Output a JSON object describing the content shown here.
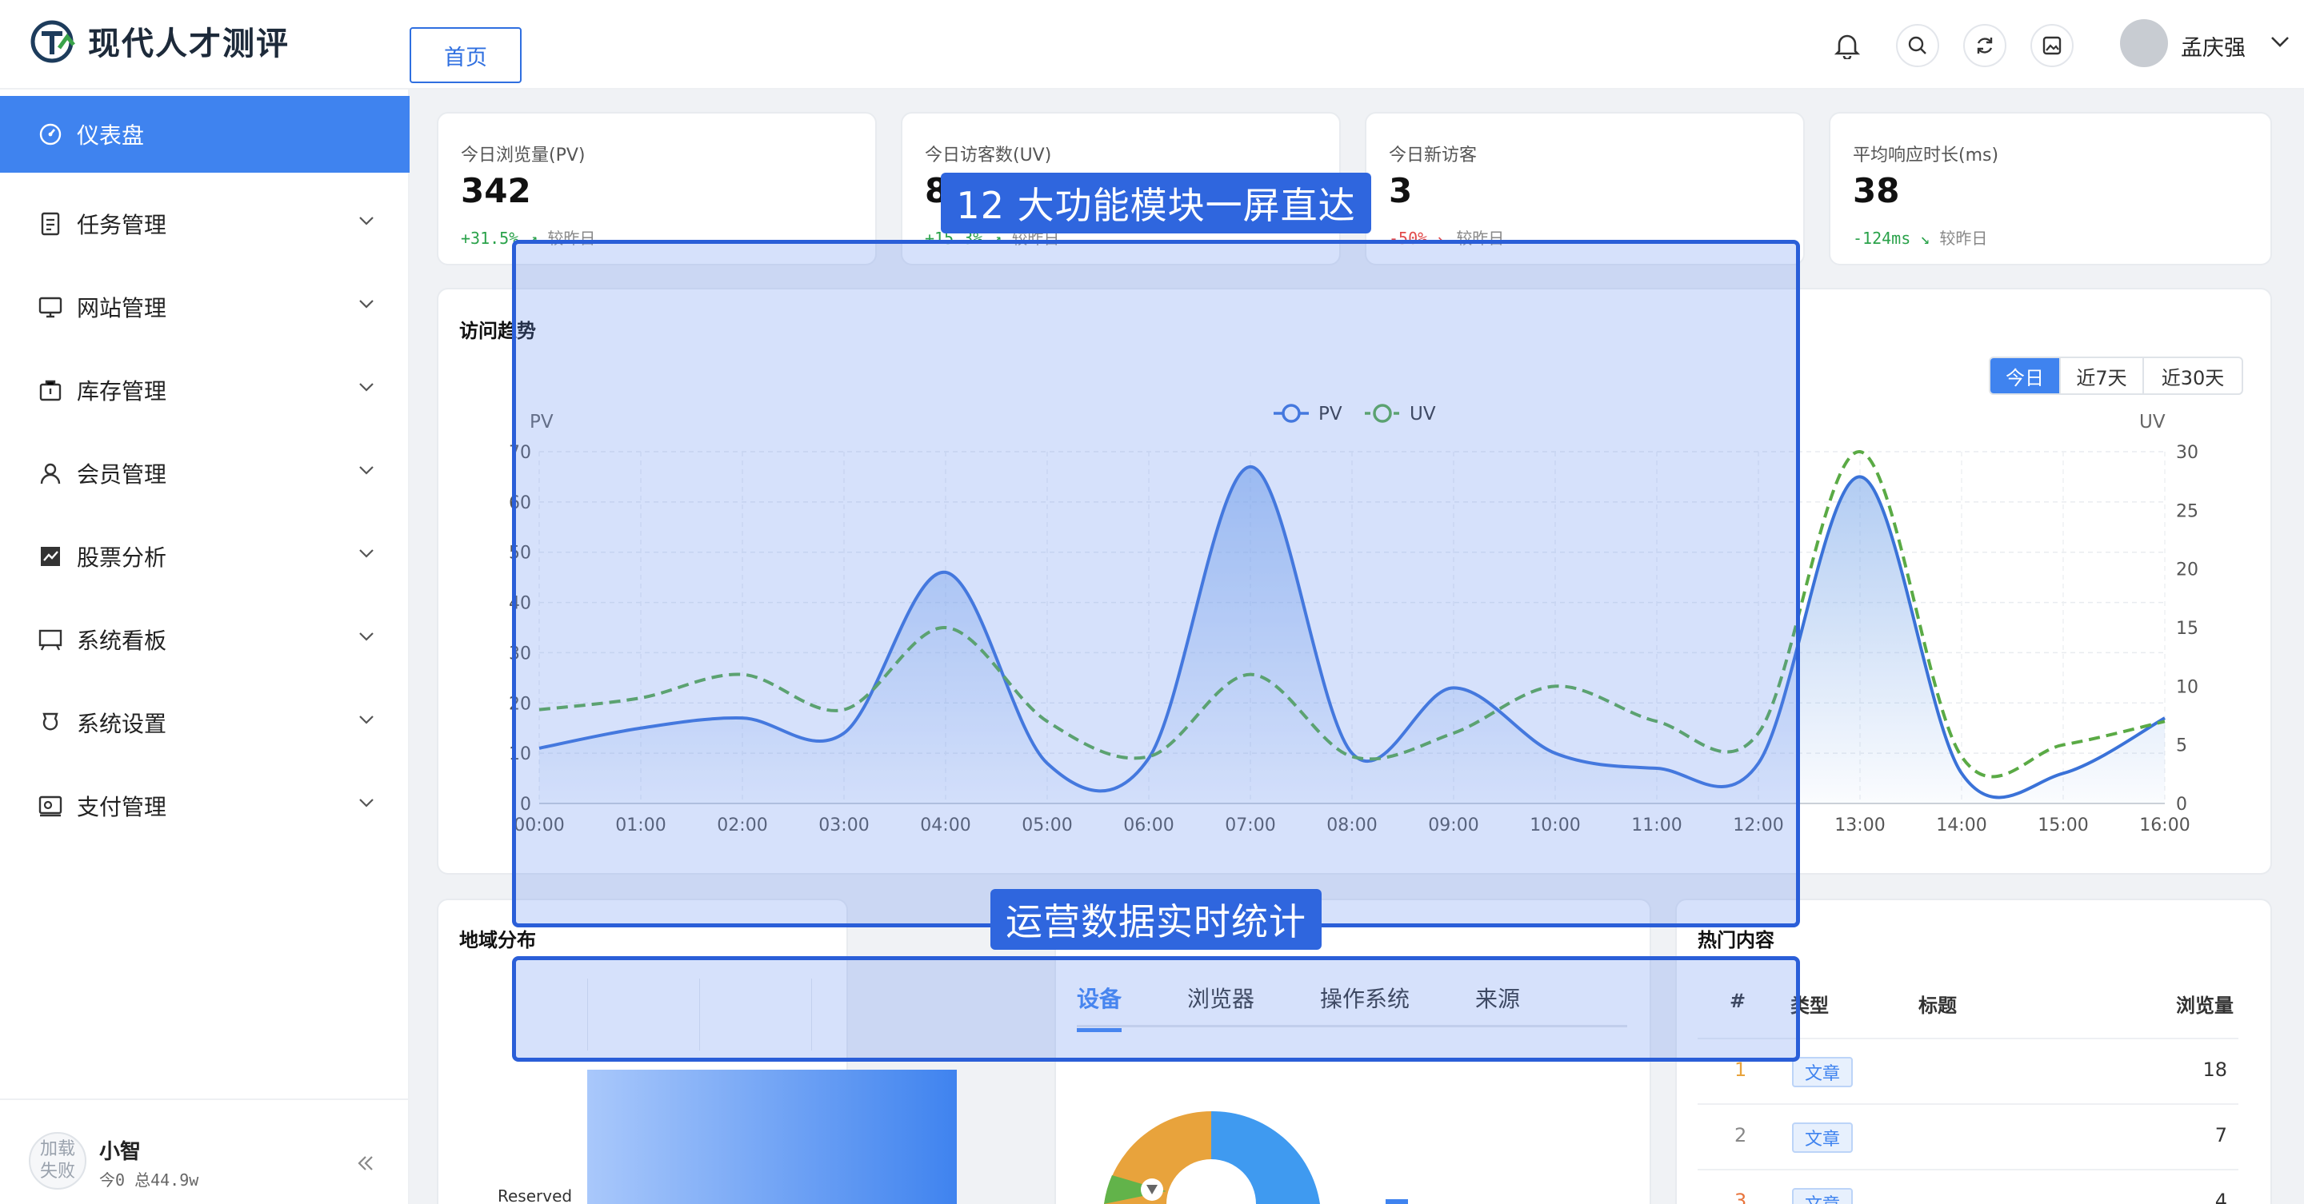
{
  "app": {
    "title": "现代人才测评",
    "home_tab": "首页"
  },
  "header": {
    "user_name": "孟庆强"
  },
  "sidebar": {
    "items": [
      {
        "label": "仪表盘",
        "icon": "dashboard-icon"
      },
      {
        "label": "任务管理",
        "icon": "task-icon"
      },
      {
        "label": "网站管理",
        "icon": "monitor-icon"
      },
      {
        "label": "库存管理",
        "icon": "inventory-icon"
      },
      {
        "label": "会员管理",
        "icon": "user-icon"
      },
      {
        "label": "股票分析",
        "icon": "stock-chart-icon"
      },
      {
        "label": "系统看板",
        "icon": "board-icon"
      },
      {
        "label": "系统设置",
        "icon": "settings-icon"
      },
      {
        "label": "支付管理",
        "icon": "payment-icon"
      }
    ],
    "footer": {
      "avatar_text_1": "加载",
      "avatar_text_2": "失败",
      "name": "小智",
      "stats": "今0 总44.9w"
    }
  },
  "stats": [
    {
      "label": "今日浏览量(PV)",
      "value": "342",
      "delta": "+31.5%",
      "direction": "up",
      "compare": "较昨日"
    },
    {
      "label": "今日访客数(UV)",
      "value": "8",
      "delta": "+15.3%",
      "direction": "up",
      "compare": "较昨日"
    },
    {
      "label": "今日新访客",
      "value": "3",
      "delta": "-50%",
      "direction": "down",
      "compare": "较昨日"
    },
    {
      "label": "平均响应时长(ms)",
      "value": "38",
      "delta": "-124ms",
      "direction": "down-good",
      "compare": "较昨日"
    }
  ],
  "trend": {
    "title": "访问趋势",
    "ranges": [
      "今日",
      "近7天",
      "近30天"
    ],
    "active_range": "今日"
  },
  "chart_data": {
    "type": "line",
    "title": "",
    "x": [
      "00:00",
      "01:00",
      "02:00",
      "03:00",
      "04:00",
      "05:00",
      "06:00",
      "07:00",
      "08:00",
      "09:00",
      "10:00",
      "11:00",
      "12:00",
      "13:00",
      "14:00",
      "15:00",
      "16:00"
    ],
    "series": [
      {
        "name": "PV",
        "axis": "left",
        "style": "solid-area",
        "color": "#3a72d8",
        "values": [
          11,
          15,
          17,
          14,
          46,
          8,
          9,
          67,
          10,
          23,
          10,
          7,
          8,
          65,
          6,
          6,
          17
        ]
      },
      {
        "name": "UV",
        "axis": "right",
        "style": "dashed",
        "color": "#5aaa45",
        "values": [
          8,
          9,
          11,
          8,
          15,
          7,
          4,
          11,
          4,
          6,
          10,
          7,
          6,
          30,
          4,
          5,
          7
        ]
      }
    ],
    "ylabel": "PV",
    "y2label": "UV",
    "ylim": [
      0,
      70
    ],
    "y2lim": [
      0,
      30
    ],
    "yticks": [
      0,
      10,
      20,
      30,
      40,
      50,
      60,
      70
    ],
    "y2ticks": [
      0,
      5,
      10,
      15,
      20,
      25,
      30
    ],
    "grid": true,
    "legend": "top-center"
  },
  "geo": {
    "title": "地域分布",
    "axis_label": "Reserved"
  },
  "device": {
    "tabs": [
      "设备",
      "浏览器",
      "操作系统",
      "来源"
    ],
    "active": "设备"
  },
  "hot": {
    "title": "热门内容",
    "columns": [
      "#",
      "类型",
      "标题",
      "浏览量"
    ],
    "rows": [
      {
        "rank": "1",
        "type": "文章",
        "title": "",
        "views": "18"
      },
      {
        "rank": "2",
        "type": "文章",
        "title": "",
        "views": "7"
      },
      {
        "rank": "3",
        "type": "文章",
        "title": "",
        "views": "4"
      }
    ]
  },
  "overlays": {
    "label_top": "12 大功能模块一屏直达",
    "label_bottom": "运营数据实时统计"
  }
}
